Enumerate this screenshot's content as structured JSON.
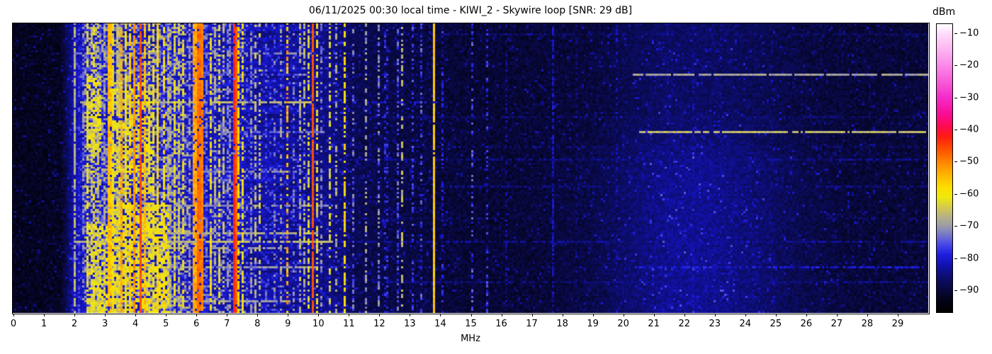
{
  "chart_data": {
    "type": "heatmap",
    "subtype": "radio-spectrum-waterfall",
    "title": "06/11/2025 00:30 local time - KIWI_2 - Skywire loop [SNR: 29 dB]",
    "station": "KIWI_2",
    "antenna": "Skywire loop",
    "snr_db": 29,
    "datetime_local": "06/11/2025 00:30",
    "xlabel": "MHz",
    "x_range_mhz": [
      0,
      30
    ],
    "x_ticks": [
      0,
      1,
      2,
      3,
      4,
      5,
      6,
      7,
      8,
      9,
      10,
      11,
      12,
      13,
      14,
      15,
      16,
      17,
      18,
      19,
      20,
      21,
      22,
      23,
      24,
      25,
      26,
      27,
      28,
      29
    ],
    "colorbar": {
      "label": "dBm",
      "range_dbm": [
        -97,
        -7
      ],
      "ticks_dbm": [
        -10,
        -20,
        -30,
        -40,
        -50,
        -60,
        -70,
        -80,
        -90
      ]
    },
    "colormap_stops": [
      [
        -97,
        "#000000"
      ],
      [
        -93,
        "#030318"
      ],
      [
        -90,
        "#08083c"
      ],
      [
        -86,
        "#0d0d6e"
      ],
      [
        -82,
        "#1212b4"
      ],
      [
        -79,
        "#1e1ee0"
      ],
      [
        -76,
        "#4444e8"
      ],
      [
        -73,
        "#7474cc"
      ],
      [
        -70,
        "#9c9ca8"
      ],
      [
        -67,
        "#b8b284"
      ],
      [
        -64,
        "#d6cc48"
      ],
      [
        -61,
        "#f0e80c"
      ],
      [
        -58,
        "#fddd00"
      ],
      [
        -54,
        "#ffb300"
      ],
      [
        -50,
        "#ff8400"
      ],
      [
        -46,
        "#ff4e00"
      ],
      [
        -42,
        "#ff1a14"
      ],
      [
        -39,
        "#fe0a50"
      ],
      [
        -35,
        "#f90c96"
      ],
      [
        -30,
        "#f42cc8"
      ],
      [
        -25,
        "#f75ad8"
      ],
      [
        -20,
        "#fa88e8"
      ],
      [
        -15,
        "#fcb4f2"
      ],
      [
        -10,
        "#fedcfa"
      ],
      [
        -7,
        "#ffffff"
      ]
    ],
    "noise_floor_dbm_by_mhz": [
      [
        0,
        -94.5
      ],
      [
        1.6,
        -94
      ],
      [
        1.78,
        -90
      ],
      [
        1.98,
        -85
      ],
      [
        2.4,
        -82.5
      ],
      [
        5.8,
        -83
      ],
      [
        7.0,
        -84
      ],
      [
        9.0,
        -85.5
      ],
      [
        10.5,
        -87
      ],
      [
        11.3,
        -90.5
      ],
      [
        13,
        -91.5
      ],
      [
        15,
        -92.5
      ],
      [
        17,
        -92.5
      ],
      [
        19,
        -92
      ],
      [
        20.3,
        -90
      ],
      [
        21.5,
        -88.8
      ],
      [
        23,
        -89
      ],
      [
        24.5,
        -90
      ],
      [
        26,
        -91.5
      ],
      [
        27.5,
        -92.3
      ],
      [
        30,
        -92.3
      ]
    ],
    "signal_bands": {
      "fields": "[center_mhz, width_mhz, level_dbm, duty_cycle, variation_db]",
      "rows": [
        [
          2.02,
          0.07,
          -61,
          0.8,
          6
        ],
        [
          2.17,
          0.05,
          -74,
          0.55,
          8
        ],
        [
          2.3,
          0.05,
          -67,
          0.6,
          8
        ],
        [
          2.47,
          0.06,
          -62,
          0.7,
          6
        ],
        [
          2.66,
          0.2,
          -61,
          0.5,
          9
        ],
        [
          2.85,
          0.06,
          -62,
          0.6,
          6
        ],
        [
          3.0,
          0.05,
          -65,
          0.6,
          8
        ],
        [
          3.2,
          0.08,
          -50,
          0.9,
          6
        ],
        [
          3.33,
          0.06,
          -57,
          0.75,
          6
        ],
        [
          3.48,
          0.05,
          -60,
          0.7,
          6
        ],
        [
          3.58,
          0.07,
          -52,
          0.85,
          6
        ],
        [
          3.7,
          0.06,
          -58,
          0.75,
          6
        ],
        [
          3.85,
          0.06,
          -55,
          0.8,
          6
        ],
        [
          3.98,
          0.08,
          -48,
          0.9,
          5
        ],
        [
          4.2,
          0.09,
          -44,
          0.95,
          4
        ],
        [
          4.35,
          0.06,
          -55,
          0.75,
          6
        ],
        [
          4.5,
          0.05,
          -60,
          0.65,
          8
        ],
        [
          4.65,
          0.06,
          -57,
          0.7,
          6
        ],
        [
          4.8,
          0.07,
          -53,
          0.8,
          6
        ],
        [
          4.98,
          0.06,
          -58,
          0.7,
          6
        ],
        [
          5.15,
          0.05,
          -62,
          0.6,
          8
        ],
        [
          5.3,
          0.06,
          -58,
          0.7,
          6
        ],
        [
          5.45,
          0.05,
          -63,
          0.6,
          8
        ],
        [
          5.6,
          0.05,
          -60,
          0.6,
          8
        ],
        [
          5.78,
          0.05,
          -64,
          0.5,
          8
        ],
        [
          5.95,
          0.1,
          -53,
          0.85,
          6
        ],
        [
          6.08,
          0.12,
          -47,
          0.9,
          5
        ],
        [
          6.19,
          0.08,
          -44,
          0.92,
          4
        ],
        [
          6.35,
          0.05,
          -70,
          0.5,
          8
        ],
        [
          6.5,
          0.06,
          -60,
          0.7,
          7
        ],
        [
          6.62,
          0.05,
          -63,
          0.6,
          7
        ],
        [
          6.8,
          0.05,
          -60,
          0.55,
          7
        ],
        [
          6.95,
          0.05,
          -62,
          0.5,
          7
        ],
        [
          7.1,
          0.05,
          -65,
          0.5,
          8
        ],
        [
          7.28,
          0.15,
          -42,
          0.96,
          4
        ],
        [
          7.43,
          0.06,
          -55,
          0.7,
          6
        ],
        [
          7.56,
          0.05,
          -60,
          0.6,
          7
        ],
        [
          7.8,
          0.04,
          -66,
          0.5,
          8
        ],
        [
          8.0,
          0.05,
          -62,
          0.55,
          7
        ],
        [
          8.14,
          0.04,
          -60,
          0.5,
          7
        ],
        [
          8.35,
          0.04,
          -70,
          0.4,
          8
        ],
        [
          8.6,
          0.04,
          -72,
          0.4,
          8
        ],
        [
          8.8,
          0.04,
          -68,
          0.4,
          8
        ],
        [
          9.02,
          0.05,
          -53,
          0.55,
          10
        ],
        [
          9.25,
          0.04,
          -68,
          0.4,
          8
        ],
        [
          9.45,
          0.04,
          -64,
          0.5,
          8
        ],
        [
          9.58,
          0.04,
          -66,
          0.5,
          8
        ],
        [
          9.7,
          0.04,
          -62,
          0.5,
          7
        ],
        [
          9.83,
          0.07,
          -43,
          0.97,
          3
        ],
        [
          9.96,
          0.05,
          -57,
          0.6,
          8
        ],
        [
          10.12,
          0.04,
          -70,
          0.5,
          8
        ],
        [
          10.4,
          0.04,
          -62,
          0.45,
          8
        ],
        [
          10.6,
          0.04,
          -66,
          0.45,
          8
        ],
        [
          10.9,
          0.05,
          -58,
          0.6,
          7
        ],
        [
          11.18,
          0.04,
          -72,
          0.4,
          8
        ],
        [
          11.6,
          0.04,
          -68,
          0.45,
          8
        ],
        [
          12.0,
          0.04,
          -71,
          0.45,
          8
        ],
        [
          12.25,
          0.04,
          -73,
          0.4,
          8
        ],
        [
          12.6,
          0.04,
          -70,
          0.45,
          8
        ],
        [
          12.79,
          0.04,
          -64,
          0.45,
          8
        ],
        [
          13.1,
          0.04,
          -74,
          0.35,
          8
        ],
        [
          13.4,
          0.04,
          -76,
          0.35,
          8
        ],
        [
          13.79,
          0.06,
          -52,
          0.95,
          4
        ],
        [
          14.1,
          0.04,
          -78,
          0.4,
          6
        ],
        [
          15.05,
          0.04,
          -73,
          0.4,
          8
        ],
        [
          15.55,
          0.04,
          -77,
          0.35,
          7
        ],
        [
          16.2,
          0.04,
          -81,
          0.4,
          6
        ],
        [
          17.7,
          0.04,
          -79,
          0.6,
          5
        ],
        [
          18.5,
          0.04,
          -83,
          0.4,
          6
        ],
        [
          19.8,
          0.04,
          -83,
          0.4,
          6
        ],
        [
          21.45,
          0.04,
          -81,
          0.5,
          5
        ],
        [
          22.3,
          0.04,
          -82,
          0.4,
          6
        ],
        [
          23.2,
          0.04,
          -83,
          0.4,
          6
        ],
        [
          24.9,
          0.04,
          -83,
          0.4,
          6
        ],
        [
          26.5,
          0.04,
          -85,
          0.35,
          6
        ],
        [
          28.1,
          0.04,
          -85,
          0.35,
          6
        ],
        [
          29.3,
          0.04,
          -85,
          0.35,
          6
        ]
      ]
    },
    "splatter_regions": {
      "fields": "[from_mhz, to_mhz, duty_cycle, level_dbm, variation_db]",
      "rows": [
        [
          2.4,
          5.75,
          0.4,
          -71,
          13
        ],
        [
          5.75,
          7.7,
          0.26,
          -75,
          11
        ],
        [
          7.7,
          9.6,
          0.17,
          -79,
          9
        ],
        [
          9.6,
          11.1,
          0.12,
          -81,
          8
        ],
        [
          11.1,
          13.9,
          0.05,
          -84,
          6
        ]
      ]
    },
    "activity_patches": {
      "fields": "[from_mhz, to_mhz, from_row, to_row, duty_cycle, level_dbm, variation_db]",
      "rows": [
        [
          2.45,
          2.95,
          25,
          62,
          0.55,
          -62,
          7
        ],
        [
          3.25,
          5.15,
          85,
          137,
          0.55,
          -61,
          8
        ],
        [
          3.3,
          4.6,
          28,
          80,
          0.45,
          -62,
          8
        ],
        [
          2.5,
          3.1,
          95,
          137,
          0.5,
          -62,
          7
        ]
      ]
    },
    "static_crash_rows": {
      "fields": "[row, from_mhz, to_mhz, level_dbm, duty_cycle]",
      "rows": [
        [
          5,
          10.5,
          30,
          -86.5,
          0.6
        ],
        [
          14,
          2.0,
          9.8,
          -72,
          0.7
        ],
        [
          24,
          2.0,
          10.0,
          -76,
          0.5
        ],
        [
          24,
          20.3,
          30,
          -69,
          0.92
        ],
        [
          37,
          2.2,
          9.8,
          -67,
          0.8
        ],
        [
          37,
          10.0,
          14.0,
          -80,
          0.5
        ],
        [
          44,
          10.5,
          30,
          -86.5,
          0.6
        ],
        [
          51,
          2.0,
          10.2,
          -74,
          0.6
        ],
        [
          51,
          20.5,
          30,
          -66,
          0.92
        ],
        [
          58,
          10.5,
          30,
          -86.5,
          0.5
        ],
        [
          64,
          11.0,
          30,
          -85,
          0.7
        ],
        [
          70,
          2.2,
          9.5,
          -73,
          0.6
        ],
        [
          77,
          14.0,
          30,
          -85.5,
          0.7
        ],
        [
          86,
          2.2,
          10.5,
          -72,
          0.7
        ],
        [
          92,
          10.5,
          30,
          -86.5,
          0.5
        ],
        [
          99,
          2.3,
          10.0,
          -68,
          0.85
        ],
        [
          103,
          2.0,
          10.5,
          -67,
          0.85
        ],
        [
          103,
          10.5,
          30,
          -84.5,
          0.6
        ],
        [
          106,
          2.4,
          9.0,
          -70,
          0.7
        ],
        [
          115,
          2.4,
          10.0,
          -71,
          0.75
        ],
        [
          115,
          20.5,
          30,
          -80.5,
          0.7
        ],
        [
          122,
          12.0,
          30,
          -85.5,
          0.7
        ],
        [
          131,
          2.4,
          9.2,
          -69,
          0.8
        ]
      ]
    },
    "ionospheric_cloud": {
      "center_mhz": 22.3,
      "width_mhz": 3.2,
      "row_start": 40,
      "boost_db": 3
    },
    "grid_cols": 431,
    "grid_rows": 137
  }
}
